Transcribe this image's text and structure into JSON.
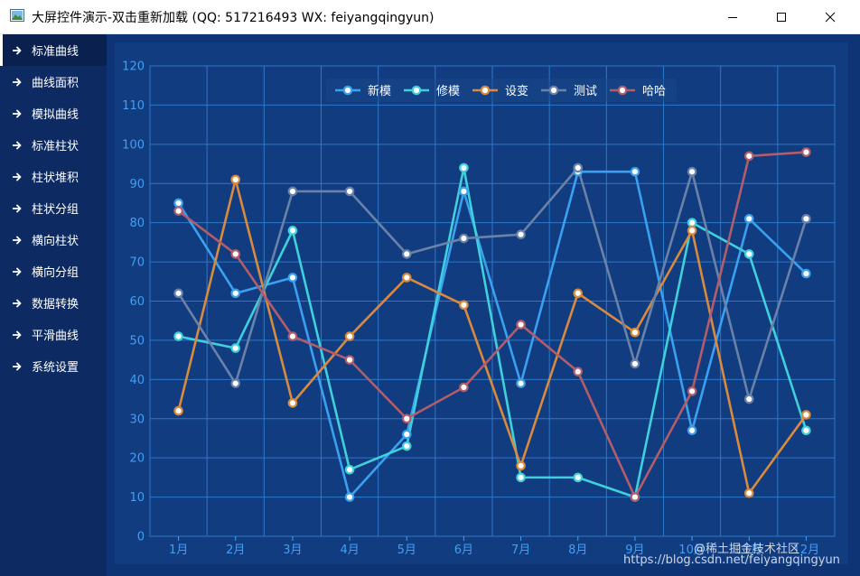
{
  "window": {
    "title": "大屏控件演示-双击重新加载 (QQ: 517216493  WX: feiyangqingyun)"
  },
  "sidebar": {
    "items": [
      {
        "label": "标准曲线",
        "active": true
      },
      {
        "label": "曲线面积"
      },
      {
        "label": "模拟曲线"
      },
      {
        "label": "标准柱状"
      },
      {
        "label": "柱状堆积"
      },
      {
        "label": "柱状分组"
      },
      {
        "label": "横向柱状"
      },
      {
        "label": "横向分组"
      },
      {
        "label": "数据转换"
      },
      {
        "label": "平滑曲线"
      },
      {
        "label": "系统设置"
      }
    ]
  },
  "chart_data": {
    "type": "line",
    "title": "",
    "xlabel": "",
    "ylabel": "",
    "ylim": [
      0,
      120
    ],
    "yticks": [
      "0",
      "10",
      "20",
      "30",
      "40",
      "50",
      "60",
      "70",
      "80",
      "90",
      "100",
      "110",
      "120"
    ],
    "categories": [
      "1月",
      "2月",
      "3月",
      "4月",
      "5月",
      "6月",
      "7月",
      "8月",
      "9月",
      "10月",
      "11月",
      "12月"
    ],
    "grid": true,
    "legend_position": "top",
    "series": [
      {
        "name": "新模",
        "color": "#3aa0f0",
        "values": [
          85,
          62,
          66,
          10,
          26,
          88,
          39,
          93,
          93,
          27,
          81,
          67
        ]
      },
      {
        "name": "修模",
        "color": "#3fd0dc",
        "values": [
          51,
          48,
          78,
          17,
          23,
          94,
          15,
          15,
          10,
          80,
          72,
          27
        ]
      },
      {
        "name": "设变",
        "color": "#d98a3c",
        "values": [
          32,
          91,
          34,
          51,
          66,
          59,
          18,
          62,
          52,
          78,
          11,
          31
        ]
      },
      {
        "name": "测试",
        "color": "#6a82a8",
        "values": [
          62,
          39,
          88,
          88,
          72,
          76,
          77,
          94,
          44,
          93,
          35,
          81
        ]
      },
      {
        "name": "哈哈",
        "color": "#b35c6a",
        "values": [
          83,
          72,
          51,
          45,
          30,
          38,
          54,
          42,
          10,
          37,
          97,
          98
        ]
      }
    ]
  },
  "watermarks": {
    "juejin": "@稀土掘金技术社区",
    "csdn": "https://blog.csdn.net/feiyangqingyun"
  }
}
